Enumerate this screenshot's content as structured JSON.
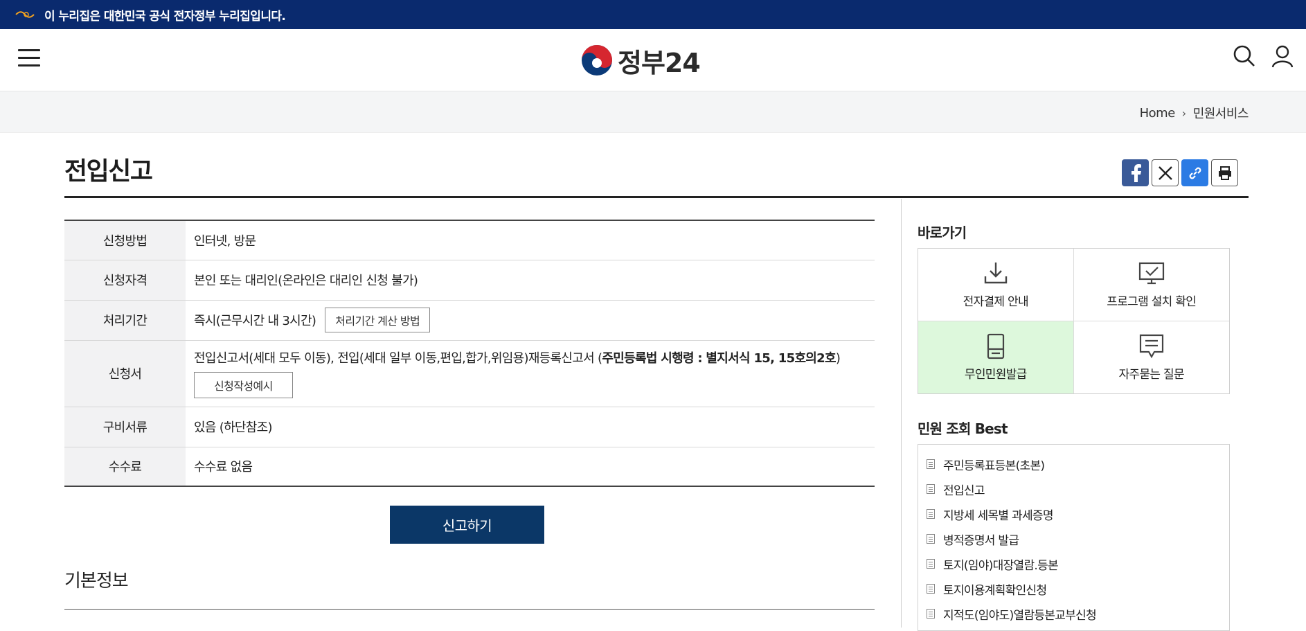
{
  "banner": {
    "text": "이 누리집은 대한민국 공식 전자정부 누리집입니다."
  },
  "header": {
    "logo_text": "정부24"
  },
  "breadcrumb": [
    "Home",
    "민원서비스"
  ],
  "page": {
    "title": "전입신고"
  },
  "table": {
    "rows": [
      {
        "label": "신청방법",
        "value": "인터넷, 방문"
      },
      {
        "label": "신청자격",
        "value": "본인 또는 대리인(온라인은 대리인 신청 불가)"
      },
      {
        "label": "처리기간",
        "value": "즉시(근무시간 내 3시간)",
        "button": "처리기간 계산 방법"
      },
      {
        "label": "신청서",
        "value": "전입신고서(세대 모두 이동), 전입(세대 일부 이동,편입,합가,위임용)재등록신고서 (",
        "value_bold": "주민등록법 시행령 : 별지서식 15, 15호의2호",
        "value_end": ")",
        "button": "신청작성예시"
      },
      {
        "label": "구비서류",
        "value": "있음 (하단참조)"
      },
      {
        "label": "수수료",
        "value": "수수료 없음"
      }
    ]
  },
  "main_button": "신고하기",
  "section": {
    "title": "기본정보"
  },
  "sidebar": {
    "quick_title": "바로가기",
    "quick": [
      "전자결제 안내",
      "프로그램 설치 확인",
      "무인민원발급",
      "자주묻는 질문"
    ],
    "best_title": "민원 조회 Best",
    "best": [
      "주민등록표등본(초본)",
      "전입신고",
      "지방세 세목별 과세증명",
      "병적증명서 발급",
      "토지(임야)대장열람.등본",
      "토지이용계획확인신청",
      "지적도(임야도)열람등본교부신청"
    ]
  },
  "colors": {
    "banner": "#0a2a6e",
    "primary_button": "#0b3767",
    "highlight_cell": "#ddf8dc"
  }
}
